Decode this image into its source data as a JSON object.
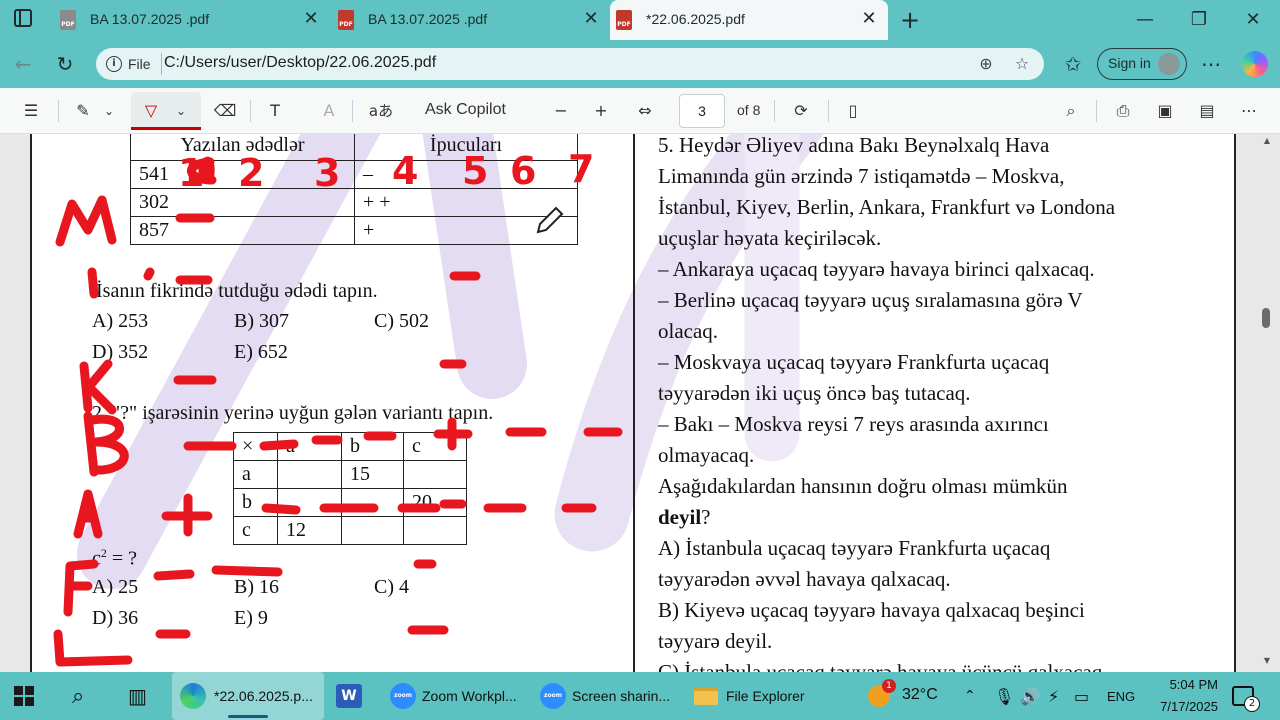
{
  "browser": {
    "tabs": [
      {
        "title": "BA 13.07.2025 .pdf",
        "active": false
      },
      {
        "title": "BA 13.07.2025 .pdf",
        "active": false
      },
      {
        "title": "*22.06.2025.pdf",
        "active": true
      }
    ],
    "file_label": "File",
    "url": "C:/Users/user/Desktop/22.06.2025.pdf",
    "signin_label": "Sign in",
    "accent_color": "#5fc3c3"
  },
  "pdf_toolbar": {
    "ask_copilot": "Ask Copilot",
    "read_aloud": "aあ",
    "page_current": "3",
    "page_total": "of 8",
    "draw_color": "#c80000"
  },
  "left": {
    "table1": {
      "headers": [
        "Yazılan ədədlər",
        "İpucuları"
      ],
      "rows": [
        [
          "541",
          "–"
        ],
        [
          "302",
          "+ +"
        ],
        [
          "857",
          "+"
        ]
      ]
    },
    "q1_text": "İsanın fikrində tutduğu ədədi tapın.",
    "q1_options": [
      "A) 253",
      "B) 307",
      "C) 502",
      "D) 352",
      "E) 652"
    ],
    "q2_text": "2. \"?\" işarəsinin yerinə uyğun gələn variantı tapın.",
    "table2": {
      "header": [
        "×",
        "a",
        "b",
        "c"
      ],
      "rows": [
        [
          "a",
          "",
          "15",
          ""
        ],
        [
          "b",
          "",
          "",
          "20"
        ],
        [
          "c",
          "12",
          "",
          ""
        ]
      ]
    },
    "q2_expr_base": "c",
    "q2_expr_sup": "2",
    "q2_expr_rest": " = ?",
    "q2_options": [
      "A) 25",
      "B) 16",
      "C) 4",
      "D) 36",
      "E) 9"
    ]
  },
  "annotations": {
    "numbers": [
      "1",
      "2",
      "3",
      "4",
      "5",
      "6",
      "7"
    ],
    "letters": [
      "M",
      "i",
      "K",
      "B",
      "A",
      "F",
      "L"
    ]
  },
  "right": {
    "lines": [
      "5. Heydər Əliyev adına Bakı Beynəlxalq Hava",
      "Limanında gün ərzində 7 istiqamətdə – Moskva,",
      "İstanbul, Kiyev, Berlin, Ankara, Frankfurt və Londona",
      "uçuşlar həyata keçiriləcək.",
      "–  Ankaraya uçacaq təyyarə havaya birinci qalxacaq.",
      "–  Berlinə uçacaq təyyarə uçuş  sıralamasına görə V",
      "olacaq.",
      "– Moskvaya uçacaq təyyarə Frankfurta uçacaq",
      "təyyarədən iki uçuş öncə baş tutacaq.",
      "– Bakı – Moskva reysi 7 reys arasında axırıncı",
      "olmayacaq.",
      "Aşağıdakılardan hansının doğru olması mümkün"
    ],
    "bold_word": "deyil",
    "bold_suffix": "?",
    "answers": [
      "A) İstanbula uçacaq təyyarə Frankfurta uçacaq",
      "təyyarədən əvvəl havaya qalxacaq.",
      "B) Kiyevə uçacaq təyyarə havaya qalxacaq beşinci",
      "təyyarə deyil.",
      "C) İstanbula uçacaq təyyarə havaya üçüncü qalxacaq"
    ]
  },
  "taskbar": {
    "edge_label": "*22.06.2025.p...",
    "zoom1_label": "Zoom Workpl...",
    "zoom2_label": "Screen sharin...",
    "explorer_label": "File Explorer",
    "zoom_icon_text": "zoom",
    "weather_badge": "1",
    "temperature": "32°C",
    "language": "ENG",
    "time": "5:04 PM",
    "date": "7/17/2025",
    "notification_count": "2"
  }
}
